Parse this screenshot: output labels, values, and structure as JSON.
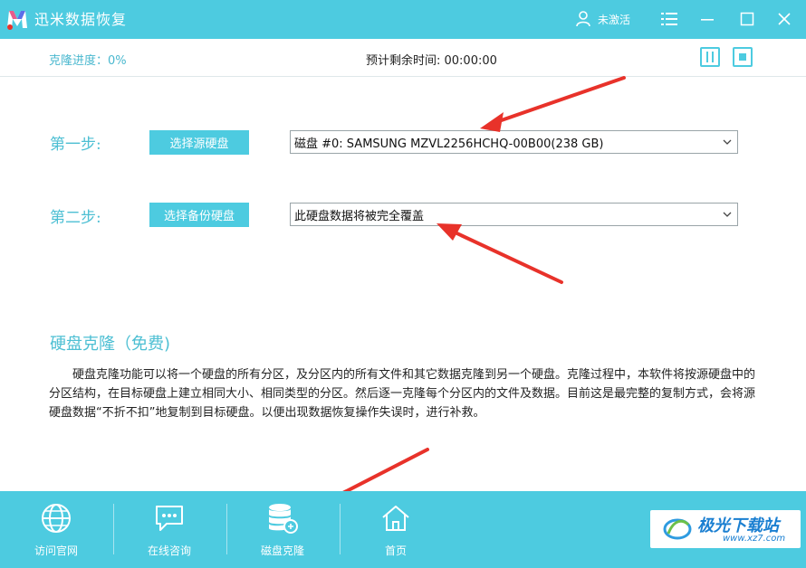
{
  "app": {
    "title": "迅米数据恢复"
  },
  "header": {
    "user_label": "未激活"
  },
  "progress": {
    "label": "克隆进度：0%",
    "remaining": "预计剩余时间:  00:00:00"
  },
  "steps": [
    {
      "label": "第一步:",
      "button": "选择源硬盘",
      "selected": "磁盘 #0: SAMSUNG MZVL2256HCHQ-00B00(238 GB)"
    },
    {
      "label": "第二步:",
      "button": "选择备份硬盘",
      "selected": "此硬盘数据将被完全覆盖"
    }
  ],
  "section": {
    "title": "硬盘克隆（免费)",
    "description": "硬盘克隆功能可以将一个硬盘的所有分区，及分区内的所有文件和其它数据克隆到另一个硬盘。克隆过程中，本软件将按源硬盘中的分区结构，在目标硬盘上建立相同大小、相同类型的分区。然后逐一克隆每个分区内的文件及数据。目前这是最完整的复制方式，会将源硬盘数据“不折不扣”地复制到目标硬盘。以便出现数据恢复操作失误时，进行补救。"
  },
  "bottom_nav": [
    {
      "label": "访问官网",
      "icon": "globe-icon"
    },
    {
      "label": "在线咨询",
      "icon": "chat-icon"
    },
    {
      "label": "磁盘克隆",
      "icon": "disk-clone-icon"
    },
    {
      "label": "首页",
      "icon": "home-icon"
    }
  ],
  "watermark": {
    "text": "极光下载站",
    "url": "www.xz7.com"
  },
  "colors": {
    "accent": "#4dcbe0",
    "arrow": "#e8322a"
  }
}
